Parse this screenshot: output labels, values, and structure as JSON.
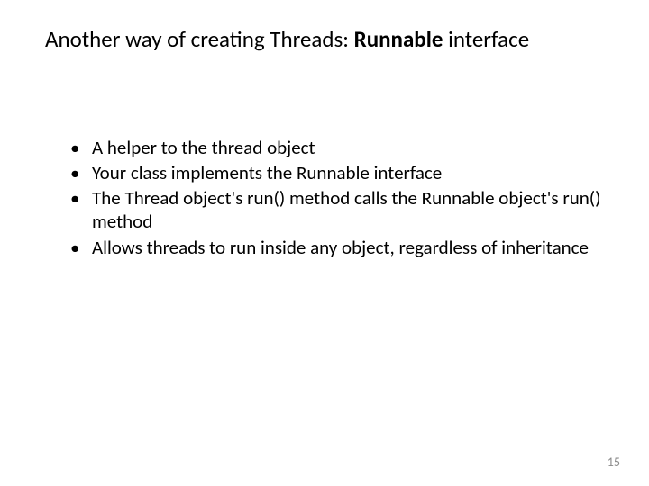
{
  "title": {
    "prefix": "Another way of creating Threads: ",
    "bold_part": "Runnable",
    "suffix": " interface"
  },
  "bullets": [
    "A helper to the thread object",
    "Your class implements the Runnable interface",
    "The Thread object's run() method calls the Runnable object's run() method",
    "Allows threads to run inside any object, regardless of inheritance"
  ],
  "page_number": "15"
}
